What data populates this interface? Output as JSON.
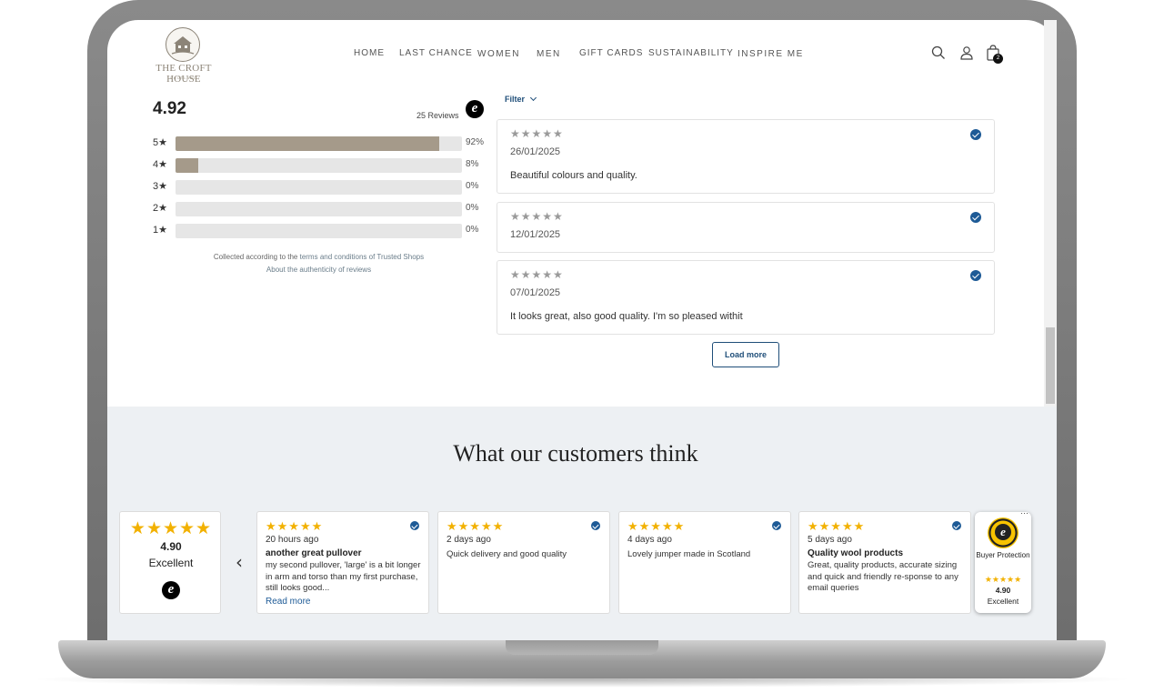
{
  "header": {
    "logo_text": "THE CROFT HOUSE",
    "logo_sub": "SCOTLAND",
    "nav": [
      "HOME",
      "LAST CHANCE",
      "WOMEN",
      "MEN",
      "GIFT CARDS",
      "SUSTAINABILITY",
      "INSPIRE ME"
    ],
    "cart_count": "2"
  },
  "summary": {
    "score": "4.92",
    "reviews_count": "25 Reviews",
    "badge_letter": "e",
    "bars": [
      {
        "label": "5★",
        "pct": "92%",
        "fill": 0.92
      },
      {
        "label": "4★",
        "pct": "8%",
        "fill": 0.08
      },
      {
        "label": "3★",
        "pct": "0%",
        "fill": 0
      },
      {
        "label": "2★",
        "pct": "0%",
        "fill": 0
      },
      {
        "label": "1★",
        "pct": "0%",
        "fill": 0
      }
    ],
    "collected_prefix": "Collected according to the ",
    "collected_link": "terms and conditions of Trusted Shops",
    "authenticity_link": "About the authenticity of reviews"
  },
  "reviews": {
    "filter_label": "Filter",
    "stars": "★★★★★",
    "items": [
      {
        "date": "26/01/2025",
        "text": "Beautiful colours and quality."
      },
      {
        "date": "12/01/2025",
        "text": ""
      },
      {
        "date": "07/01/2025",
        "text": "It looks great, also good quality. I'm so pleased withit"
      }
    ],
    "load_more": "Load more"
  },
  "customers": {
    "title": "What our customers think",
    "summary": {
      "stars": "★★★★★",
      "value": "4.90",
      "label": "Excellent",
      "badge_letter": "e"
    },
    "prev_arrow": "‹",
    "cards": [
      {
        "stars": "★★★★★",
        "ago": "20 hours ago",
        "title": "another great pullover",
        "body": "my second pullover, 'large' is a bit longer in arm and torso than my first purchase, still looks good...",
        "more": "Read more"
      },
      {
        "stars": "★★★★★",
        "ago": "2 days ago",
        "title": "",
        "body": "Quick delivery and good quality",
        "more": ""
      },
      {
        "stars": "★★★★★",
        "ago": "4 days ago",
        "title": "",
        "body": "Lovely jumper made in Scotland",
        "more": ""
      },
      {
        "stars": "★★★★★",
        "ago": "5 days ago",
        "title": "Quality wool products",
        "body": "Great, quality products, accurate sizing and quick and friendly re-sponse to any email queries",
        "more": ""
      }
    ],
    "buyer": {
      "seal_letter": "e",
      "label": "Buyer Protection",
      "stars": "★★★★★",
      "value": "4.90",
      "rating_label": "Excellent",
      "menu": "···"
    }
  },
  "colors": {
    "bar_fill": "#a59a8a",
    "accent_blue": "#1f4e79",
    "gold": "#f2b100",
    "section_bg": "#edf0f3"
  }
}
